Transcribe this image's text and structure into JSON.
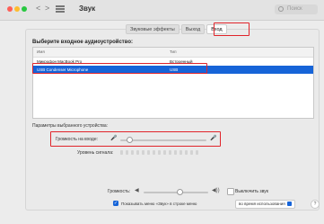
{
  "window": {
    "title": "Звук",
    "search_placeholder": "Поиск"
  },
  "toolbar": {
    "back_label": "<",
    "forward_label": ">"
  },
  "tabs": [
    {
      "label": "Звуковые эффекты"
    },
    {
      "label": "Выход"
    },
    {
      "label": "Вход"
    }
  ],
  "input": {
    "heading": "Выберите входное аудиоустройство:",
    "columns": [
      "Имя",
      "Тип"
    ],
    "devices": [
      {
        "name": "Микрофон MacBook Pro",
        "type": "Встроенный"
      },
      {
        "name": "USB Condenser Microphone",
        "type": "USB"
      }
    ],
    "selected_index": 1
  },
  "params": {
    "heading": "Параметры выбранного устройства:",
    "input_volume_label": "Громкость на входе:",
    "input_volume_level": 0.1,
    "input_level_label": "Уровень сигнала:"
  },
  "footer": {
    "output_volume_label": "Громкость:",
    "output_volume_level": 0.55,
    "mute_label": "Выключить звук",
    "show_in_menubar_label": "Показывать меню «Звук» в строке меню",
    "menubar_mode": "во время использования"
  },
  "colors": {
    "highlight": "#e0242a",
    "accent": "#1664d8"
  },
  "icons": {
    "search": "search-icon",
    "grid": "grid-icon",
    "mic_low": "mic-low-icon",
    "mic_high": "mic-high-icon",
    "speaker_low": "speaker-low-icon",
    "speaker_high": "speaker-high-icon",
    "help": "help-icon"
  }
}
